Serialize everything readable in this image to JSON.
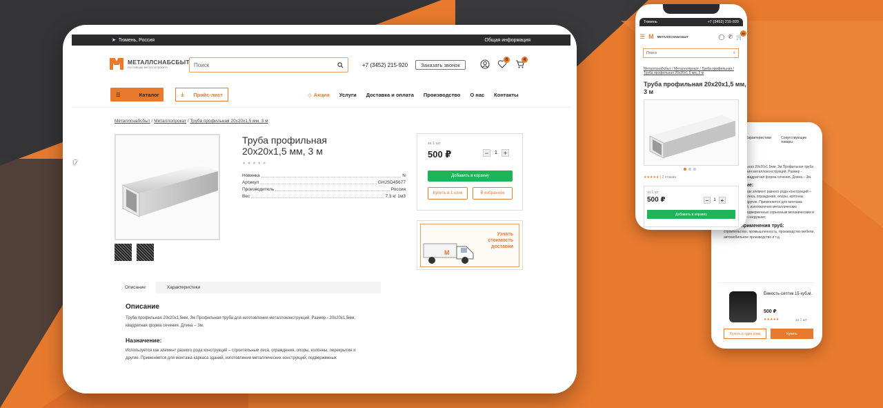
{
  "topbar": {
    "location": "Тюмень, Россия",
    "info_link": "Общая информация"
  },
  "logo": {
    "name": "МЕТАЛЛСНАБСБЫТ",
    "tagline": "поставщик металлопроката"
  },
  "search": {
    "placeholder": "Поиск"
  },
  "header": {
    "phone": "+7 (3452) 215-920",
    "callback_label": "Заказать звонок",
    "favorites_count": "0",
    "cart_count": "4"
  },
  "nav": {
    "catalog_label": "Каталог",
    "pricelist_label": "Прайс-лист",
    "links": [
      "Акции",
      "Услуги",
      "Доставка и оплата",
      "Производство",
      "О нас",
      "Контакты"
    ]
  },
  "breadcrumb": [
    "Металлснабсбыт",
    "Металлопрокат",
    "Труба профильная 20х20х1,5 мм, 3 м"
  ],
  "product": {
    "title_line1": "Труба профильная",
    "title_line2": "20х20х1,5 мм, 3 м",
    "stars": "★★★★★",
    "specs": [
      {
        "label": "Новинка",
        "value": "N"
      },
      {
        "label": "Артикул",
        "value": "GHJSD45677"
      },
      {
        "label": "Производитель",
        "value": "Россия"
      },
      {
        "label": "Вес",
        "value": "7,3 кг 1м3"
      }
    ]
  },
  "buybox": {
    "unit": "за 1 шт",
    "price": "500 ₽",
    "qty": "1",
    "add_to_cart": "Добавить в корзину",
    "buy_one_click": "Купить в 1 клик",
    "to_favorites": "В избранное"
  },
  "delivery": {
    "line1": "Узнать",
    "line2": "стоимость",
    "line3": "доставки"
  },
  "tabs": [
    "Описание",
    "Характеристики"
  ],
  "description": {
    "heading": "Описание",
    "text": "Труба профильная 20х20х1,5мм, 3м Профильная труба для изготовления металлоконструкций. Размер - 20х20х1,5мм, квадратная форма сечения. Длина – 3м.",
    "purpose_heading": "Назначение:",
    "purpose_text": "Используется как элемент разного рода конструкций – строительные леса, ограждения, опоры, колонны, перекрытия и другие. Применяется для монтажа каркаса зданий, изготовления металлических конструкций, подверженных"
  },
  "mobile": {
    "city": "Тюмень",
    "phone": "+7 (3452) 215-920",
    "cart_count": "50",
    "search_placeholder": "Поиск",
    "breadcrumb": "Металлснабсбыт / Металлопрокат / Труба профильная / Труба профильная 20х20х1,5 мм, 3 м",
    "title": "Труба профильная 20х20х1,5 мм, 3 м",
    "rating": "★★★★★",
    "reviews": "2 отзыва",
    "unit": "за 1 шт",
    "price": "500 ₽",
    "qty": "1",
    "add_to_cart": "Добавить в корзину"
  },
  "mobile2": {
    "tab1": "Характеристики",
    "tab2": "Сопутствующие товары",
    "heading1": "Описание",
    "text1": "Труба профильная 20х20х1,5мм, 3м Профильная труба для изготовления металлоконструкций. Размер - 20х20х1,5мм, квадратная форма сечения. Длина – 3м.",
    "heading2": "Назначение:",
    "text2": "Используется как элемент разного рода конструкций – строительные леса, ограждения, опоры, колонны, перекрытия и другие. Применяется для монтажа каркаса зданий, изготовления металлических конструкций, подверженных сорьезным механическим и вибрационным нагрузкам;",
    "heading3": "Сфера применения труб:",
    "text3": "строительство, промышленность, производство мебели, автомобильное производство и т.д.",
    "card_name": "Ёмкость-септик 15 куб.м.",
    "card_price": "500 ₽",
    "card_stars": "★★★★★",
    "card_unit": "за 1 шт",
    "btn_one_click": "Купить в один клик",
    "btn_buy": "Купить"
  },
  "colors": {
    "accent": "#e87a2e",
    "green": "#1fb45a",
    "dark": "#2b2b2d"
  }
}
